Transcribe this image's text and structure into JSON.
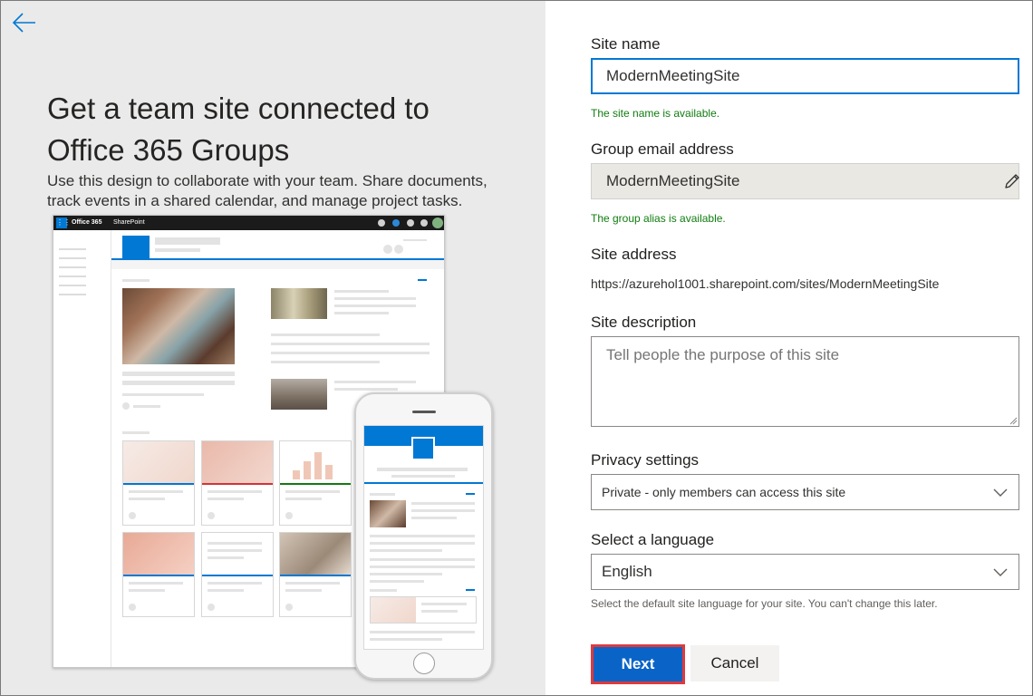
{
  "hero": {
    "title_line1": "Get a team site connected to",
    "title_line2": "Office 365 Groups",
    "description": "Use this design to collaborate with your team. Share documents, track events in a shared calendar, and manage project tasks."
  },
  "preview": {
    "brand": "Office 365",
    "app": "SharePoint"
  },
  "form": {
    "site_name": {
      "label": "Site name",
      "value": "ModernMeetingSite",
      "status": "The site name is available."
    },
    "group_email": {
      "label": "Group email address",
      "value": "ModernMeetingSite",
      "status": "The group alias is available."
    },
    "site_address": {
      "label": "Site address",
      "value": "https://azurehol1001.sharepoint.com/sites/ModernMeetingSite"
    },
    "site_description": {
      "label": "Site description",
      "placeholder": "Tell people the purpose of this site"
    },
    "privacy": {
      "label": "Privacy settings",
      "value": "Private - only members can access this site"
    },
    "language": {
      "label": "Select a language",
      "value": "English",
      "hint": "Select the default site language for your site. You can't change this later."
    },
    "buttons": {
      "next": "Next",
      "cancel": "Cancel"
    }
  },
  "colors": {
    "accent": "#0078d4",
    "success": "#107c10",
    "highlight_border": "#e0393c"
  },
  "icons": [
    "back-arrow-icon",
    "pencil-icon",
    "chevron-down-icon"
  ]
}
